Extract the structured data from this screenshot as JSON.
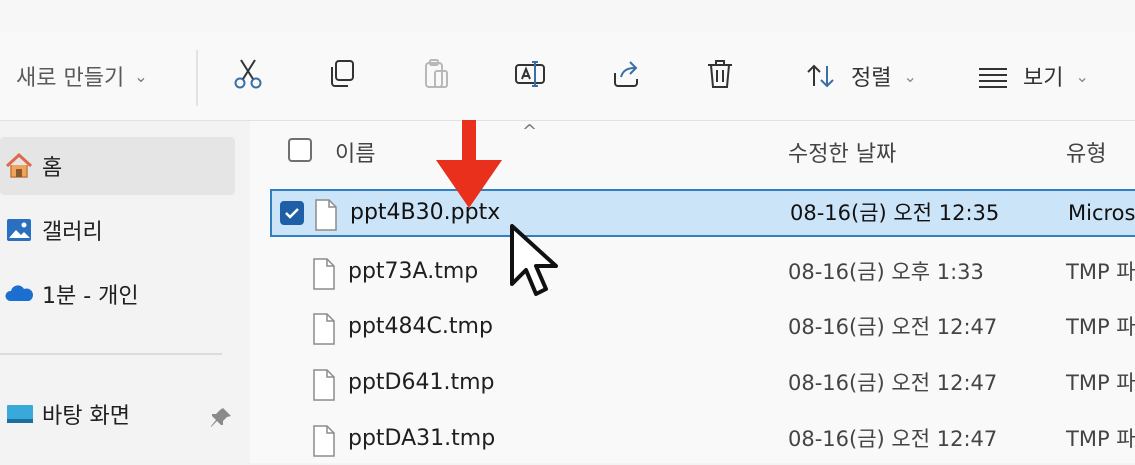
{
  "toolbar": {
    "new_label": "새로 만들기",
    "new_chevron": "⌄",
    "buttons": [
      {
        "name": "cut-button",
        "icon": "scissors-icon"
      },
      {
        "name": "copy-button",
        "icon": "copy-icon"
      },
      {
        "name": "paste-button",
        "icon": "paste-icon",
        "disabled": true
      },
      {
        "name": "rename-button",
        "icon": "rename-icon"
      },
      {
        "name": "share-button",
        "icon": "share-icon"
      },
      {
        "name": "delete-button",
        "icon": "trash-icon"
      }
    ],
    "sort_label": "정렬",
    "view_label": "보기",
    "chevron": "⌄"
  },
  "sidebar": {
    "items": [
      {
        "label": "홈",
        "icon": "home-icon",
        "active": true
      },
      {
        "label": "갤러리",
        "icon": "gallery-icon"
      },
      {
        "label": "1분 - 개인",
        "icon": "onedrive-cloud-icon"
      },
      {
        "label": "바탕 화면",
        "icon": "desktop-icon",
        "pinned": true
      }
    ]
  },
  "columns": {
    "name": "이름",
    "date": "수정한 날짜",
    "type": "유형",
    "sort_indicator": "^"
  },
  "files": [
    {
      "name": "ppt4B30.pptx",
      "date": "08-16(금) 오전 12:35",
      "type": "Microso",
      "selected": true
    },
    {
      "name": "ppt73A.tmp",
      "date": "08-16(금) 오후 1:33",
      "type": "TMP 파"
    },
    {
      "name": "ppt484C.tmp",
      "date": "08-16(금) 오전 12:47",
      "type": "TMP 파"
    },
    {
      "name": "pptD641.tmp",
      "date": "08-16(금) 오전 12:47",
      "type": "TMP 파"
    },
    {
      "name": "pptDA31.tmp",
      "date": "08-16(금) 오전 12:47",
      "type": "TMP 파"
    }
  ],
  "colors": {
    "accent": "#1e5fa8",
    "selection_bg": "#cce4f7",
    "annotation_red": "#e8301c"
  }
}
